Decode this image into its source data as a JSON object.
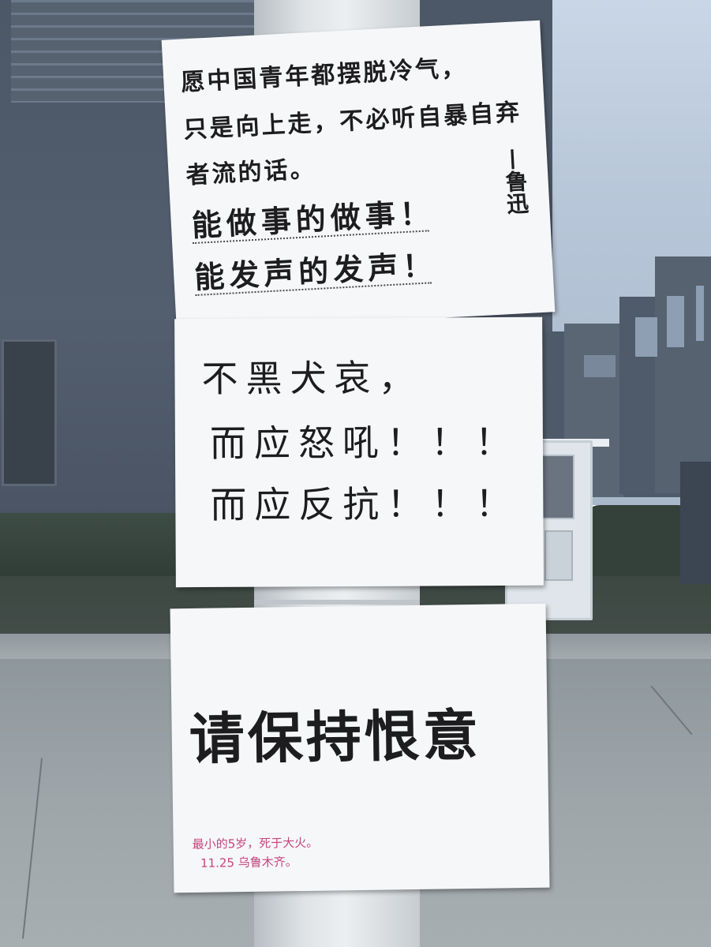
{
  "signs": {
    "top": {
      "lines": [
        "愿中国青年都摆脱冷气，",
        "只是向上走，不必听自暴自弃",
        "者流的话。"
      ],
      "emphasis": [
        "能做事的做事！",
        "能发声的发声！"
      ],
      "attribution": "—鲁迅"
    },
    "middle": {
      "lines": [
        "不黑犬哀，",
        "而应怒吼！！！",
        "而应反抗！！！"
      ]
    },
    "bottom": {
      "main": "请保持恨意",
      "note_lines": [
        "最小的5岁，死于大火。",
        "11.25 乌鲁木齐。"
      ]
    }
  }
}
